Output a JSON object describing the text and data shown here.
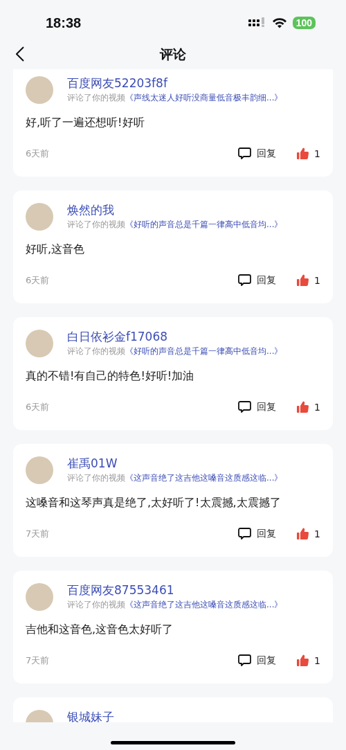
{
  "status_bar": {
    "time": "18:38",
    "battery": "100"
  },
  "nav": {
    "title": "评论"
  },
  "comments": [
    {
      "user": "百度网友52203f8f",
      "action": "评论了你的视频",
      "video": "《声线太迷人好听没商量低音极丰韵细...》",
      "text": "好,听了一遍还想听!好听",
      "time": "6天前",
      "reply": "回复",
      "likes": "1"
    },
    {
      "user": "焕然的我",
      "action": "评论了你的视频",
      "video": "《好听的声音总是千篇一律高中低音均...》",
      "text": "好听,这音色",
      "time": "6天前",
      "reply": "回复",
      "likes": "1"
    },
    {
      "user": "白日依衫金f17068",
      "action": "评论了你的视频",
      "video": "《好听的声音总是千篇一律高中低音均...》",
      "text": "真的不错!有自己的特色!好听!加油",
      "time": "6天前",
      "reply": "回复",
      "likes": "1"
    },
    {
      "user": "崔禹01W",
      "action": "评论了你的视频",
      "video": "《这声音绝了这吉他这嗓音这质感这临...》",
      "text": "这嗓音和这琴声真是绝了,太好听了!太震撼,太震撼了",
      "time": "7天前",
      "reply": "回复",
      "likes": "1"
    },
    {
      "user": "百度网友87553461",
      "action": "评论了你的视频",
      "video": "《这声音绝了这吉他这嗓音这质感这临...》",
      "text": "吉他和这音色,这音色太好听了",
      "time": "7天前",
      "reply": "回复",
      "likes": "1"
    },
    {
      "user": "银城妹子"
    }
  ]
}
